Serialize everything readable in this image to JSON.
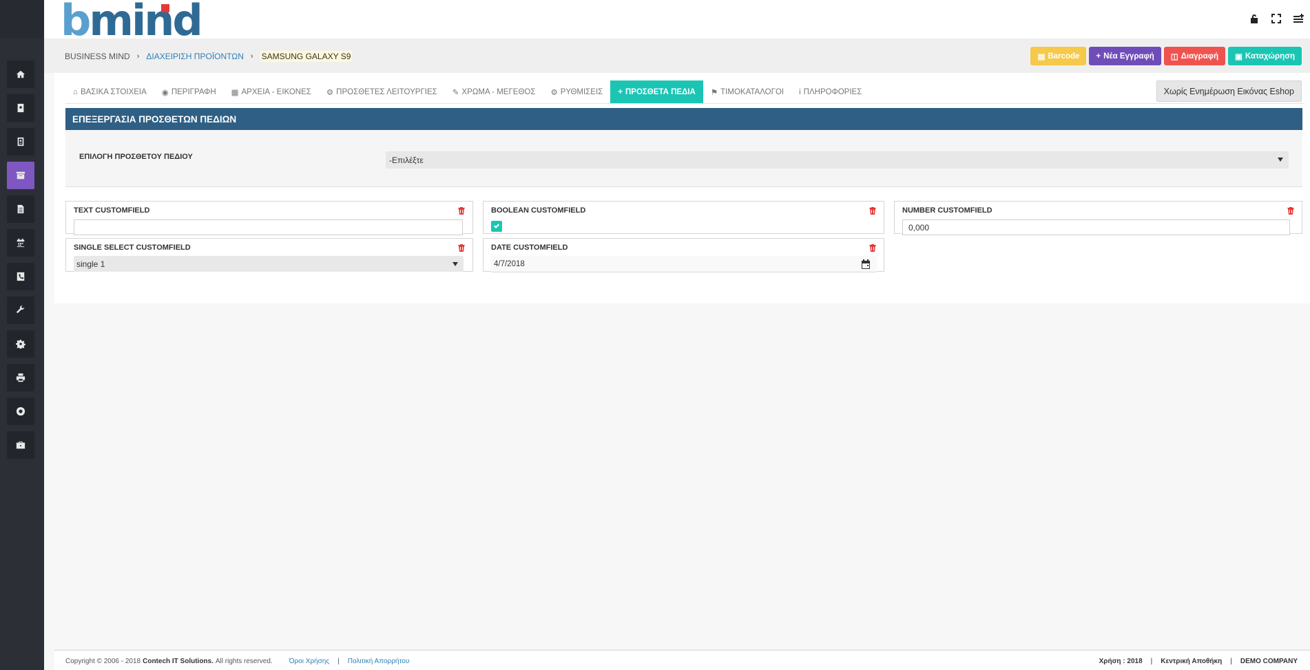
{
  "header": {
    "logo_b": "b",
    "logo_rest": "mind",
    "icons": [
      "lock-open-icon",
      "fullscreen-icon",
      "menu-add-icon"
    ]
  },
  "sidebar": {
    "items": [
      {
        "icon": "home-icon",
        "active": false
      },
      {
        "icon": "address-book-icon",
        "active": false
      },
      {
        "icon": "contact-card-icon",
        "active": false
      },
      {
        "icon": "archive-icon",
        "active": true
      },
      {
        "icon": "document-icon",
        "active": false
      },
      {
        "icon": "calendar-icon",
        "active": false
      },
      {
        "icon": "phone-icon",
        "active": false
      },
      {
        "icon": "wrench-icon",
        "active": false
      },
      {
        "icon": "gear-icon",
        "active": false
      },
      {
        "icon": "print-icon",
        "active": false
      },
      {
        "icon": "lifebuoy-icon",
        "active": false
      },
      {
        "icon": "briefcase-icon",
        "active": false
      }
    ]
  },
  "breadcrumb": {
    "home": "BUSINESS MIND",
    "section": "ΔΙΑΧΕΙΡΙΣΗ ΠΡΟΪΟΝΤΩΝ",
    "current": "SAMSUNG GALAXY S9"
  },
  "actions": {
    "barcode": "Barcode",
    "new": "Νέα Εγγραφή",
    "delete": "Διαγραφή",
    "save": "Καταχώρηση"
  },
  "tabs": [
    {
      "label": "ΒΑΣΙΚΑ ΣΤΟΙΧΕΙΑ",
      "icon": "home-icon"
    },
    {
      "label": "ΠΕΡΙΓΡΑΦΗ",
      "icon": "comments-icon"
    },
    {
      "label": "ΑΡΧΕΙΑ - ΕΙΚΟΝΕΣ",
      "icon": "image-file-icon"
    },
    {
      "label": "ΠΡΟΣΘΕΤΕΣ ΛΕΙΤΟΥΡΓΙΕΣ",
      "icon": "cogs-icon"
    },
    {
      "label": "ΧΡΩΜΑ - ΜΕΓΕΘΟΣ",
      "icon": "brush-icon"
    },
    {
      "label": "ΡΥΘΜΙΣΕΙΣ",
      "icon": "gear-icon"
    },
    {
      "label": "ΠΡΟΣΘΕΤΑ ΠΕΔΙΑ",
      "icon": "plus-icon",
      "active": true
    },
    {
      "label": "ΤΙΜΟΚΑΤΑΛΟΓΟΙ",
      "icon": "tag-icon"
    },
    {
      "label": "ΠΛΗΡΟΦΟΡΙΕΣ",
      "icon": "info-icon"
    }
  ],
  "eshop_button": "Χωρίς Ενημέρωση Εικόνας Eshop",
  "section_title": "ΕΠΕΞΕΡΓΑΣΙΑ ΠΡΟΣΘΕΤΩΝ ΠΕΔΙΩΝ",
  "field_select": {
    "label": "ΕΠΙΛΟΓΗ ΠΡΟΣΘΕΤΟΥ ΠΕΔΙΟΥ",
    "value": "-Επιλέξτε"
  },
  "fields": {
    "text": {
      "label": "TEXT CUSTOMFIELD",
      "value": ""
    },
    "boolean": {
      "label": "BOOLEAN CUSTOMFIELD",
      "checked": true
    },
    "number": {
      "label": "NUMBER CUSTOMFIELD",
      "value": "0,000"
    },
    "single_select": {
      "label": "SINGLE SELECT CUSTOMFIELD",
      "value": "single 1"
    },
    "date": {
      "label": "DATE CUSTOMFIELD",
      "value": "4/7/2018"
    }
  },
  "footer": {
    "copyright": "Copyright © 2006 - 2018",
    "company": "Contech IT Solutions.",
    "rights": "All rights reserved.",
    "terms": "Όροι Χρήσης",
    "privacy": "Πολιτική Απορρήτου",
    "year": "Χρήση : 2018",
    "warehouse": "Κεντρική Αποθήκη",
    "demo": "DEMO COMPANY"
  },
  "colors": {
    "sidebar": "#2c2f36",
    "active_sidebar": "#7e57c2",
    "teal": "#1bc5b4",
    "section_blue": "#2f5f84",
    "barcode": "#f6c94b",
    "new": "#6f4db8",
    "delete": "#ef5350"
  }
}
